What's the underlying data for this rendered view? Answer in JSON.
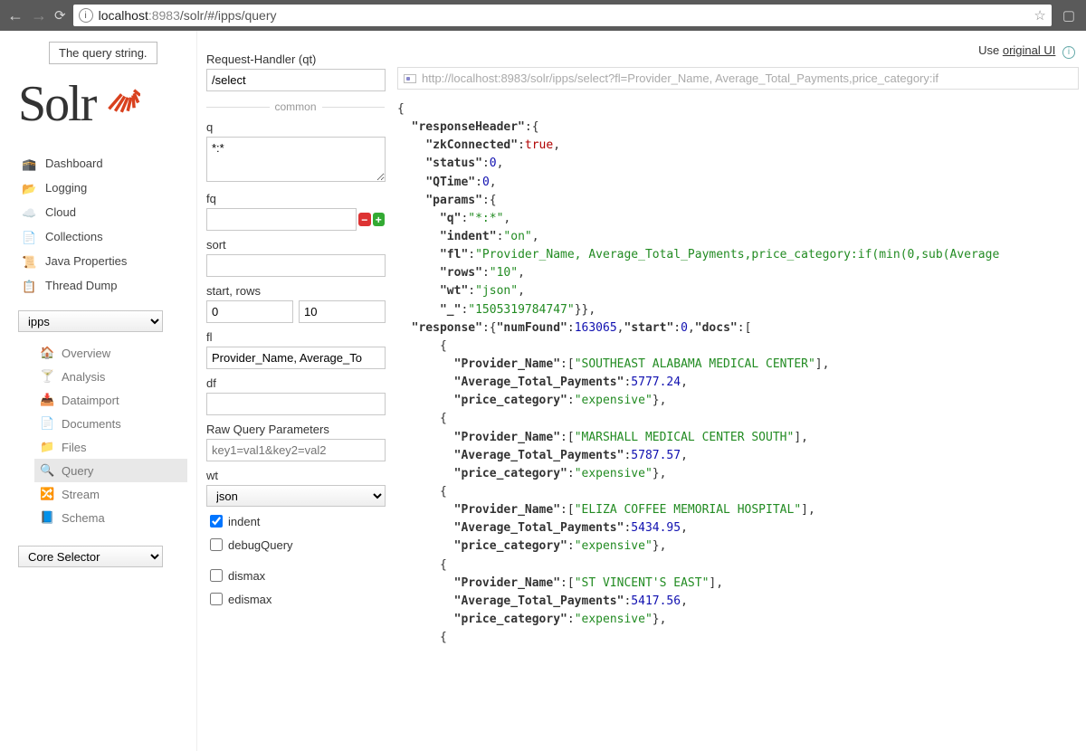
{
  "browser": {
    "url_host": "localhost",
    "url_port": ":8983",
    "url_path": "/solr/#/ipps/query"
  },
  "tooltip": "The query string.",
  "top_link": {
    "prefix": "Use ",
    "label": "original UI"
  },
  "logo_text": "Solr",
  "sidebar": {
    "items": [
      {
        "label": "Dashboard",
        "icon": "🕋"
      },
      {
        "label": "Logging",
        "icon": "📂"
      },
      {
        "label": "Cloud",
        "icon": "☁️"
      },
      {
        "label": "Collections",
        "icon": "📄"
      },
      {
        "label": "Java Properties",
        "icon": "📜"
      },
      {
        "label": "Thread Dump",
        "icon": "📋"
      }
    ],
    "core_selected": "ipps",
    "sub": [
      {
        "label": "Overview",
        "icon": "🏠"
      },
      {
        "label": "Analysis",
        "icon": "🍸"
      },
      {
        "label": "Dataimport",
        "icon": "📥"
      },
      {
        "label": "Documents",
        "icon": "📄"
      },
      {
        "label": "Files",
        "icon": "📁"
      },
      {
        "label": "Query",
        "icon": "🔍",
        "active": true
      },
      {
        "label": "Stream",
        "icon": "🔀"
      },
      {
        "label": "Schema",
        "icon": "📘"
      }
    ],
    "core_selector_label": "Core Selector"
  },
  "form": {
    "rh_label": "Request-Handler (qt)",
    "rh_value": "/select",
    "common_label": "common",
    "q_label": "q",
    "q_value": "*:*",
    "fq_label": "fq",
    "sort_label": "sort",
    "startrows_label": "start, rows",
    "start_value": "0",
    "rows_value": "10",
    "fl_label": "fl",
    "fl_value": "Provider_Name, Average_To",
    "df_label": "df",
    "raw_label": "Raw Query Parameters",
    "raw_placeholder": "key1=val1&key2=val2",
    "wt_label": "wt",
    "wt_value": "json",
    "indent_label": "indent",
    "debug_label": "debugQuery",
    "dismax_label": "dismax",
    "edismax_label": "edismax"
  },
  "result_url": "http://localhost:8983/solr/ipps/select?fl=Provider_Name, Average_Total_Payments,price_category:if",
  "response": {
    "header": {
      "zkConnected": "true",
      "status": "0",
      "QTime": "0",
      "params": {
        "q": "*:*",
        "indent": "on",
        "fl": "Provider_Name, Average_Total_Payments,price_category:if(min(0,sub(Average",
        "rows": "10",
        "wt": "json",
        "_": "1505319784747"
      }
    },
    "numFound": "163065",
    "start": "0",
    "docs": [
      {
        "Provider_Name": "SOUTHEAST ALABAMA MEDICAL CENTER",
        "Average_Total_Payments": "5777.24",
        "price_category": "expensive"
      },
      {
        "Provider_Name": "MARSHALL MEDICAL CENTER SOUTH",
        "Average_Total_Payments": "5787.57",
        "price_category": "expensive"
      },
      {
        "Provider_Name": "ELIZA COFFEE MEMORIAL HOSPITAL",
        "Average_Total_Payments": "5434.95",
        "price_category": "expensive"
      },
      {
        "Provider_Name": "ST VINCENT'S EAST",
        "Average_Total_Payments": "5417.56",
        "price_category": "expensive"
      }
    ]
  }
}
